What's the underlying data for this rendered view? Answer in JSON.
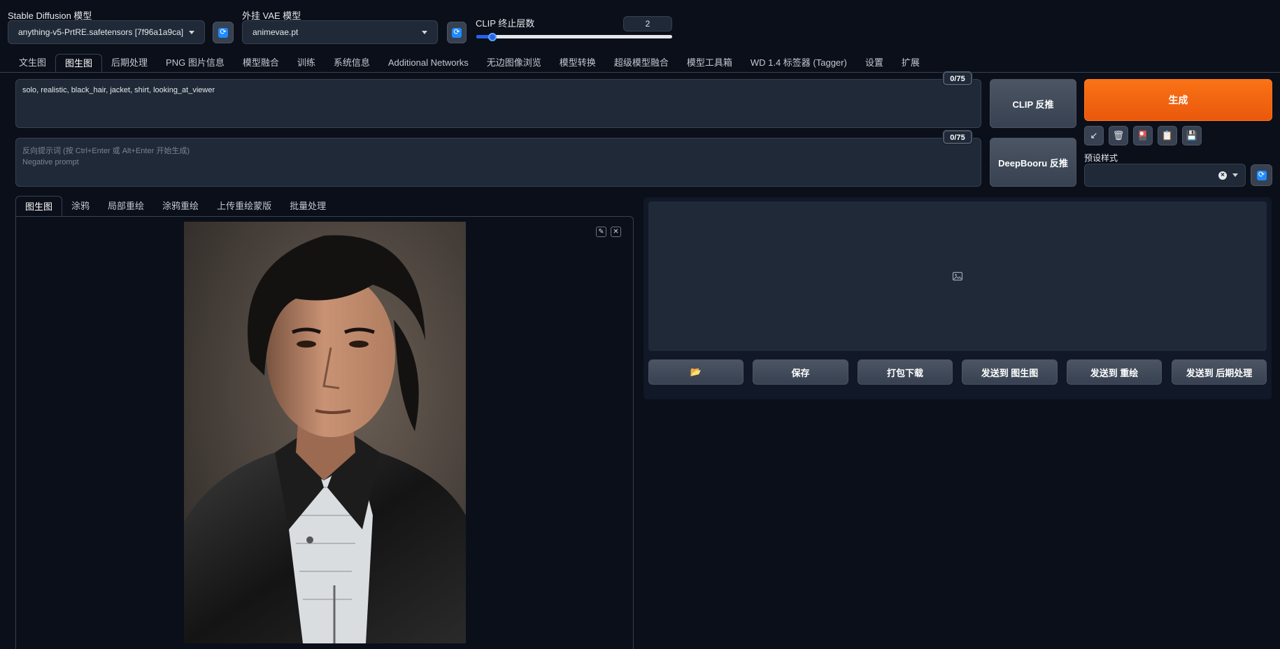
{
  "top": {
    "sd_model_label": "Stable Diffusion 模型",
    "sd_model_value": "anything-v5-PrtRE.safetensors [7f96a1a9ca]",
    "vae_label": "外挂 VAE 模型",
    "vae_value": "animevae.pt",
    "clip_label": "CLIP 终止层数",
    "clip_value": "2",
    "clip_fraction": 0.083
  },
  "main_tabs": [
    {
      "label": "文生图"
    },
    {
      "label": "图生图"
    },
    {
      "label": "后期处理"
    },
    {
      "label": "PNG 图片信息"
    },
    {
      "label": "模型融合"
    },
    {
      "label": "训练"
    },
    {
      "label": "系统信息"
    },
    {
      "label": "Additional Networks"
    },
    {
      "label": "无边图像浏览"
    },
    {
      "label": "模型转换"
    },
    {
      "label": "超级模型融合"
    },
    {
      "label": "模型工具箱"
    },
    {
      "label": "WD 1.4 标签器 (Tagger)"
    },
    {
      "label": "设置"
    },
    {
      "label": "扩展"
    }
  ],
  "prompt": {
    "value": "solo, realistic, black_hair, jacket, shirt, looking_at_viewer",
    "token_count": "0/75"
  },
  "negative_prompt": {
    "placeholder_line1": "反向提示词 (按 Ctrl+Enter 或 Alt+Enter 开始生成)",
    "placeholder_line2": "Negative prompt",
    "token_count": "0/75"
  },
  "buttons": {
    "clip_interrogate": "CLIP 反推",
    "deepbooru_interrogate": "DeepBooru 反推",
    "generate": "生成"
  },
  "styles": {
    "label": "预设样式",
    "clear_glyph": "×"
  },
  "tool_icons": [
    "↙",
    "🗑",
    "🎴",
    "📋",
    "💾"
  ],
  "sub_tabs": [
    {
      "label": "图生图"
    },
    {
      "label": "涂鸦"
    },
    {
      "label": "局部重绘"
    },
    {
      "label": "涂鸦重绘"
    },
    {
      "label": "上传重绘蒙版"
    },
    {
      "label": "批量处理"
    }
  ],
  "image_tools": {
    "edit": "✎",
    "close": "✕"
  },
  "output_buttons": {
    "open_folder": "📂",
    "save": "保存",
    "zip": "打包下载",
    "send_img2img": "发送到 图生图",
    "send_inpaint": "发送到 重绘",
    "send_extras": "发送到 后期处理"
  },
  "colors": {
    "accent": "#f97316",
    "background": "#0b0f19",
    "panel": "#1f2937",
    "link_blue": "#1f8bff"
  }
}
